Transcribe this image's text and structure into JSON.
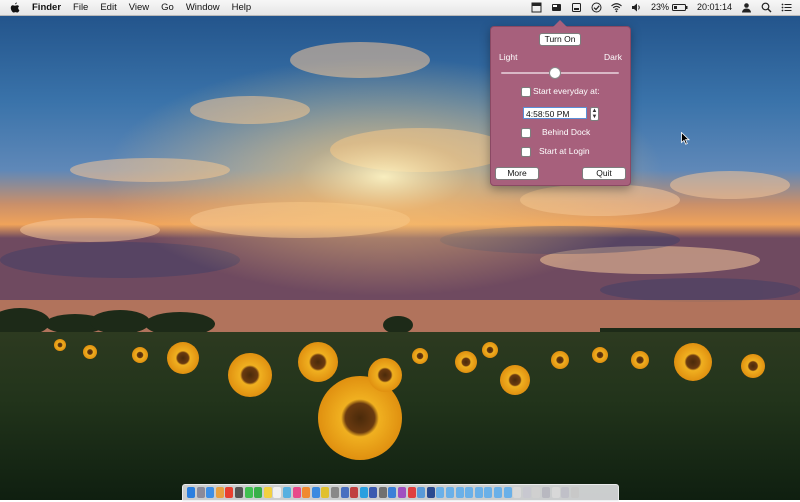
{
  "menubar": {
    "app_name": "Finder",
    "menus": [
      "File",
      "Edit",
      "View",
      "Go",
      "Window",
      "Help"
    ],
    "battery": "23%",
    "clock": "20:01:14",
    "tray_icons": [
      "app-window-icon",
      "night-mode-icon",
      "screen-icon",
      "check-icon",
      "wifi-icon",
      "volume-icon",
      "battery-icon",
      "user-icon",
      "spotlight-icon",
      "notification-list-icon"
    ]
  },
  "popover": {
    "turn_on_label": "Turn On",
    "light_label": "Light",
    "dark_label": "Dark",
    "slider_value": 0.45,
    "start_everyday_label": "Start everyday at:",
    "start_everyday_checked": false,
    "time_value": "4:58:50 PM",
    "behind_dock_label": "Behind Dock",
    "behind_dock_checked": false,
    "start_login_label": "Start at Login",
    "start_login_checked": false,
    "more_label": "More",
    "quit_label": "Quit",
    "colors": {
      "panel": "#a7607c",
      "border": "#8a4863"
    }
  },
  "dock": {
    "apps": [
      {
        "icon": "finder-icon",
        "color": "#2a7fe0"
      },
      {
        "icon": "launchpad-icon",
        "color": "#8a8a9a"
      },
      {
        "icon": "safari-icon",
        "color": "#3d8fe6"
      },
      {
        "icon": "photos-icon",
        "color": "#e8a040"
      },
      {
        "icon": "calendar-icon",
        "color": "#e84030"
      },
      {
        "icon": "app-icon",
        "color": "#555555"
      },
      {
        "icon": "messages-icon",
        "color": "#40c050"
      },
      {
        "icon": "facetime-icon",
        "color": "#38b048"
      },
      {
        "icon": "notes-icon",
        "color": "#f2d040"
      },
      {
        "icon": "reminders-icon",
        "color": "#f0f0f0"
      },
      {
        "icon": "maps-icon",
        "color": "#58b0e0"
      },
      {
        "icon": "itunes-icon",
        "color": "#e84a8a"
      },
      {
        "icon": "ibooks-icon",
        "color": "#f08a30"
      },
      {
        "icon": "app-store-icon",
        "color": "#3a8ae0"
      },
      {
        "icon": "chrome-icon",
        "color": "#e0c030"
      },
      {
        "icon": "system-prefs-icon",
        "color": "#888888"
      },
      {
        "icon": "app-icon",
        "color": "#4a70c0"
      },
      {
        "icon": "app-icon",
        "color": "#c04040"
      },
      {
        "icon": "skype-icon",
        "color": "#2aa0e0"
      },
      {
        "icon": "app-icon",
        "color": "#3a5ab0"
      },
      {
        "icon": "app-icon",
        "color": "#707070"
      },
      {
        "icon": "dropbox-icon",
        "color": "#3a80d8"
      },
      {
        "icon": "app-icon",
        "color": "#a050c0"
      },
      {
        "icon": "app-icon",
        "color": "#e04040"
      },
      {
        "icon": "app-icon",
        "color": "#5a9ad8"
      },
      {
        "icon": "app-icon",
        "color": "#2a4a90"
      },
      {
        "icon": "folder-icon",
        "color": "#6ab0e8"
      },
      {
        "icon": "folder-icon",
        "color": "#6ab0e8"
      },
      {
        "icon": "folder-icon",
        "color": "#6ab0e8"
      },
      {
        "icon": "folder-icon",
        "color": "#6ab0e8"
      },
      {
        "icon": "folder-icon",
        "color": "#6ab0e8"
      },
      {
        "icon": "folder-icon",
        "color": "#6ab0e8"
      },
      {
        "icon": "folder-icon",
        "color": "#6ab0e8"
      },
      {
        "icon": "folder-icon",
        "color": "#6ab0e8"
      },
      {
        "icon": "document-icon",
        "color": "#d8d8d8"
      },
      {
        "icon": "document-icon",
        "color": "#c8c8d0"
      },
      {
        "icon": "document-icon",
        "color": "#d0d0d0"
      },
      {
        "icon": "document-icon",
        "color": "#b8b8c0"
      },
      {
        "icon": "document-icon",
        "color": "#d8d8d8"
      },
      {
        "icon": "document-icon",
        "color": "#c0c0c8"
      },
      {
        "icon": "trash-icon",
        "color": "#c8c8c8"
      }
    ]
  }
}
